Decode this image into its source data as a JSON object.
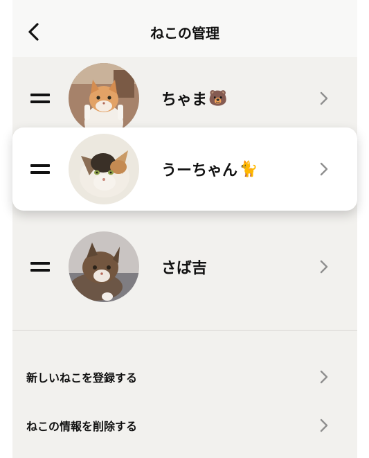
{
  "header": {
    "title": "ねこの管理",
    "back_icon": "chevron-left-icon"
  },
  "cats": [
    {
      "name": "ちゃま",
      "emoji": "🐻",
      "emoji_icon": "bear-face-icon"
    },
    {
      "name": "うーちゃん",
      "emoji": "🐈",
      "emoji_icon": "cat-icon"
    },
    {
      "name": "さば吉",
      "emoji": "",
      "emoji_icon": ""
    }
  ],
  "menu": {
    "register": "新しいねこを登録する",
    "delete": "ねこの情報を削除する"
  },
  "colors": {
    "background": "#f2f1ee",
    "header": "#f8f8f7",
    "chevron": "#8e8e8e"
  }
}
